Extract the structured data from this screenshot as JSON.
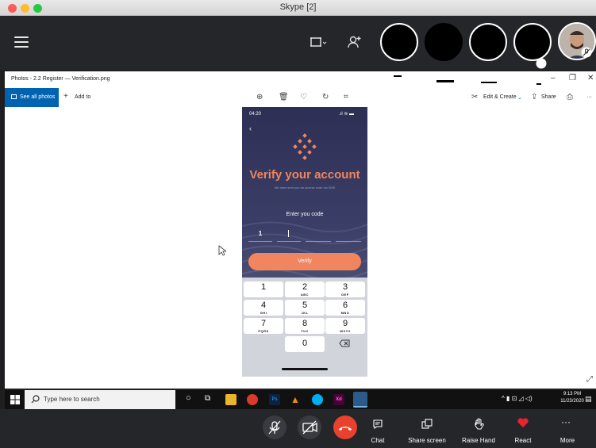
{
  "window": {
    "title": "Skype [2]"
  },
  "photos": {
    "title": "Photos - 2.2 Register — Verification.png",
    "see_all": "See all photos",
    "add_to": "Add to",
    "edit_create": "Edit & Create",
    "share": "Share",
    "more": "···"
  },
  "phone": {
    "time": "04:20",
    "heading": "Verify your account",
    "subtext": "We have sent you an access code via SMS",
    "prompt": "Enter you code",
    "digit1": "1",
    "button": "Verify",
    "keys": [
      {
        "n": "1",
        "l": ""
      },
      {
        "n": "2",
        "l": "ABC"
      },
      {
        "n": "3",
        "l": "DEF"
      },
      {
        "n": "4",
        "l": "GHI"
      },
      {
        "n": "5",
        "l": "JKL"
      },
      {
        "n": "6",
        "l": "MNO"
      },
      {
        "n": "7",
        "l": "PQRS"
      },
      {
        "n": "8",
        "l": "TUV"
      },
      {
        "n": "9",
        "l": "WXYZ"
      },
      {
        "n": "0",
        "l": ""
      }
    ]
  },
  "taskbar": {
    "search_placeholder": "Type here to search",
    "time": "9:13 PM",
    "date": "11/23/2020",
    "ps": "Ps",
    "xd": "Xd"
  },
  "call": {
    "chat": "Chat",
    "share_screen": "Share screen",
    "raise_hand": "Raise Hand",
    "react": "React",
    "more": "More"
  },
  "colors": {
    "accent": "#f0855f",
    "end_call": "#e8412d",
    "photos_blue": "#0063b1"
  }
}
